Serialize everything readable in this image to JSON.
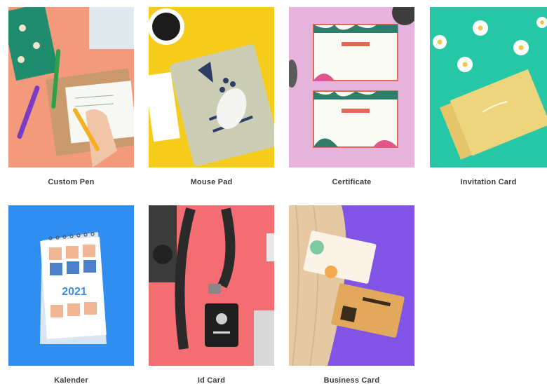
{
  "products": [
    {
      "label": "Custom Pen",
      "image_color": "#f49a7c"
    },
    {
      "label": "Mouse Pad",
      "image_color": "#f6cc1c"
    },
    {
      "label": "Certificate",
      "image_color": "#e5b3dc"
    },
    {
      "label": "Invitation Card",
      "image_color": "#25c7a6"
    },
    {
      "label": "Kalender",
      "image_color": "#2f8ef0",
      "calendar_year": "2021"
    },
    {
      "label": "Id Card",
      "image_color": "#f36d73"
    },
    {
      "label": "Business Card",
      "image_color": "#8154e6"
    }
  ]
}
